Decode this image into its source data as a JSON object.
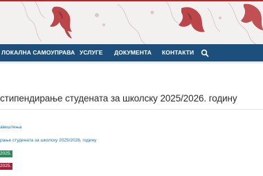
{
  "nav": {
    "items": [
      {
        "label": "ЛОКАЛНА САМОУПРАВА"
      },
      {
        "label": "УСЛУГЕ"
      },
      {
        "label": "ДОКУМЕНТА"
      },
      {
        "label": "КОНТАКТИ"
      }
    ],
    "search_icon": "search-icon"
  },
  "page": {
    "title": "стипендирање студената за школску 2025/2026. годину"
  },
  "content": {
    "link1": "авештења",
    "link2": "рање студената за школску 2025/2026. годину",
    "badge1": "2025.",
    "badge2": "2025."
  },
  "colors": {
    "brand_red": "#b3282d",
    "nav_blue": "#1d4f7c",
    "badge_green": "#2e8b57",
    "badge_red": "#a3223a",
    "link_blue": "#1a73b8"
  }
}
